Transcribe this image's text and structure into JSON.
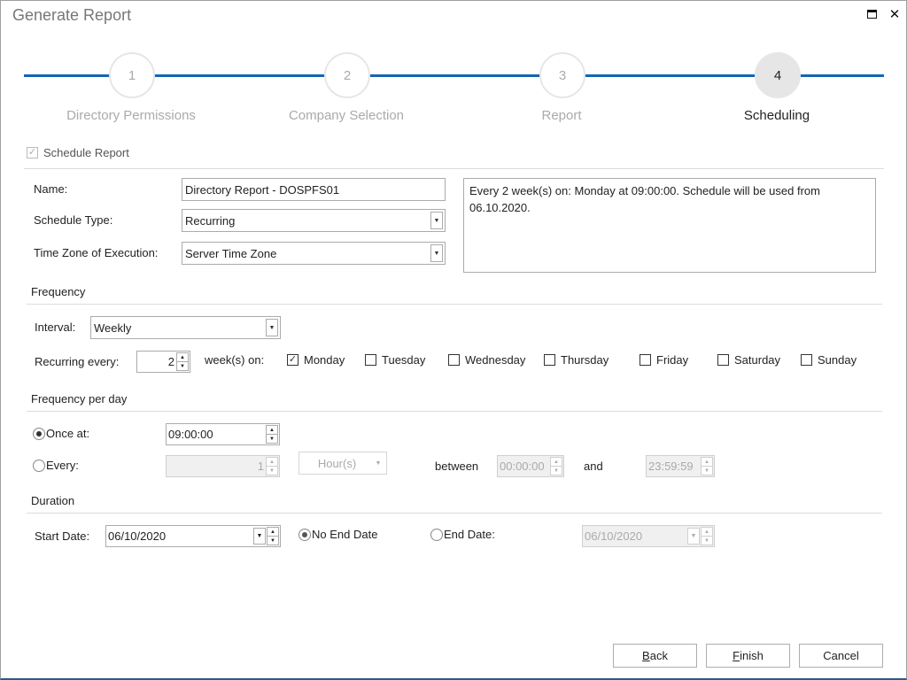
{
  "window": {
    "title": "Generate Report"
  },
  "wizard": {
    "steps": [
      {
        "number": "1",
        "label": "Directory Permissions",
        "state": "done"
      },
      {
        "number": "2",
        "label": "Company Selection",
        "state": "done"
      },
      {
        "number": "3",
        "label": "Report",
        "state": "done"
      },
      {
        "number": "4",
        "label": "Scheduling",
        "state": "active"
      }
    ],
    "accent_color": "#1565b5"
  },
  "schedule_report": {
    "label": "Schedule Report",
    "checked": true,
    "enabled": false
  },
  "general": {
    "name_label": "Name:",
    "name_value": "Directory Report - DOSPFS01",
    "schedule_type_label": "Schedule Type:",
    "schedule_type_value": "Recurring",
    "timezone_label": "Time Zone of Execution:",
    "timezone_value": "Server Time Zone",
    "summary": "Every 2 week(s) on: Monday at 09:00:00. Schedule will be used from 06.10.2020."
  },
  "frequency": {
    "title": "Frequency",
    "interval_label": "Interval:",
    "interval_value": "Weekly",
    "recurring_label": "Recurring every:",
    "recurring_value": "2",
    "weeks_on_label": "week(s) on:",
    "days": [
      {
        "label": "Monday",
        "checked": true
      },
      {
        "label": "Tuesday",
        "checked": false
      },
      {
        "label": "Wednesday",
        "checked": false
      },
      {
        "label": "Thursday",
        "checked": false
      },
      {
        "label": "Friday",
        "checked": false
      },
      {
        "label": "Saturday",
        "checked": false
      },
      {
        "label": "Sunday",
        "checked": false
      }
    ]
  },
  "frequency_per_day": {
    "title": "Frequency per day",
    "once_label": "Once at:",
    "once_selected": true,
    "once_value": "09:00:00",
    "every_label": "Every:",
    "every_selected": false,
    "every_value": "1",
    "every_unit": "Hour(s)",
    "between_label": "between",
    "between_start": "00:00:00",
    "and_label": "and",
    "between_end": "23:59:59"
  },
  "duration": {
    "title": "Duration",
    "start_label": "Start Date:",
    "start_value": "06/10/2020",
    "no_end_label": "No End Date",
    "no_end_selected": true,
    "end_label": "End Date:",
    "end_selected": false,
    "end_value": "06/10/2020"
  },
  "footer": {
    "back_label": "Back",
    "back_mnemonic": "B",
    "back_rest": "ack",
    "finish_label": "Finish",
    "finish_mnemonic": "F",
    "finish_rest": "inish",
    "cancel_label": "Cancel"
  }
}
